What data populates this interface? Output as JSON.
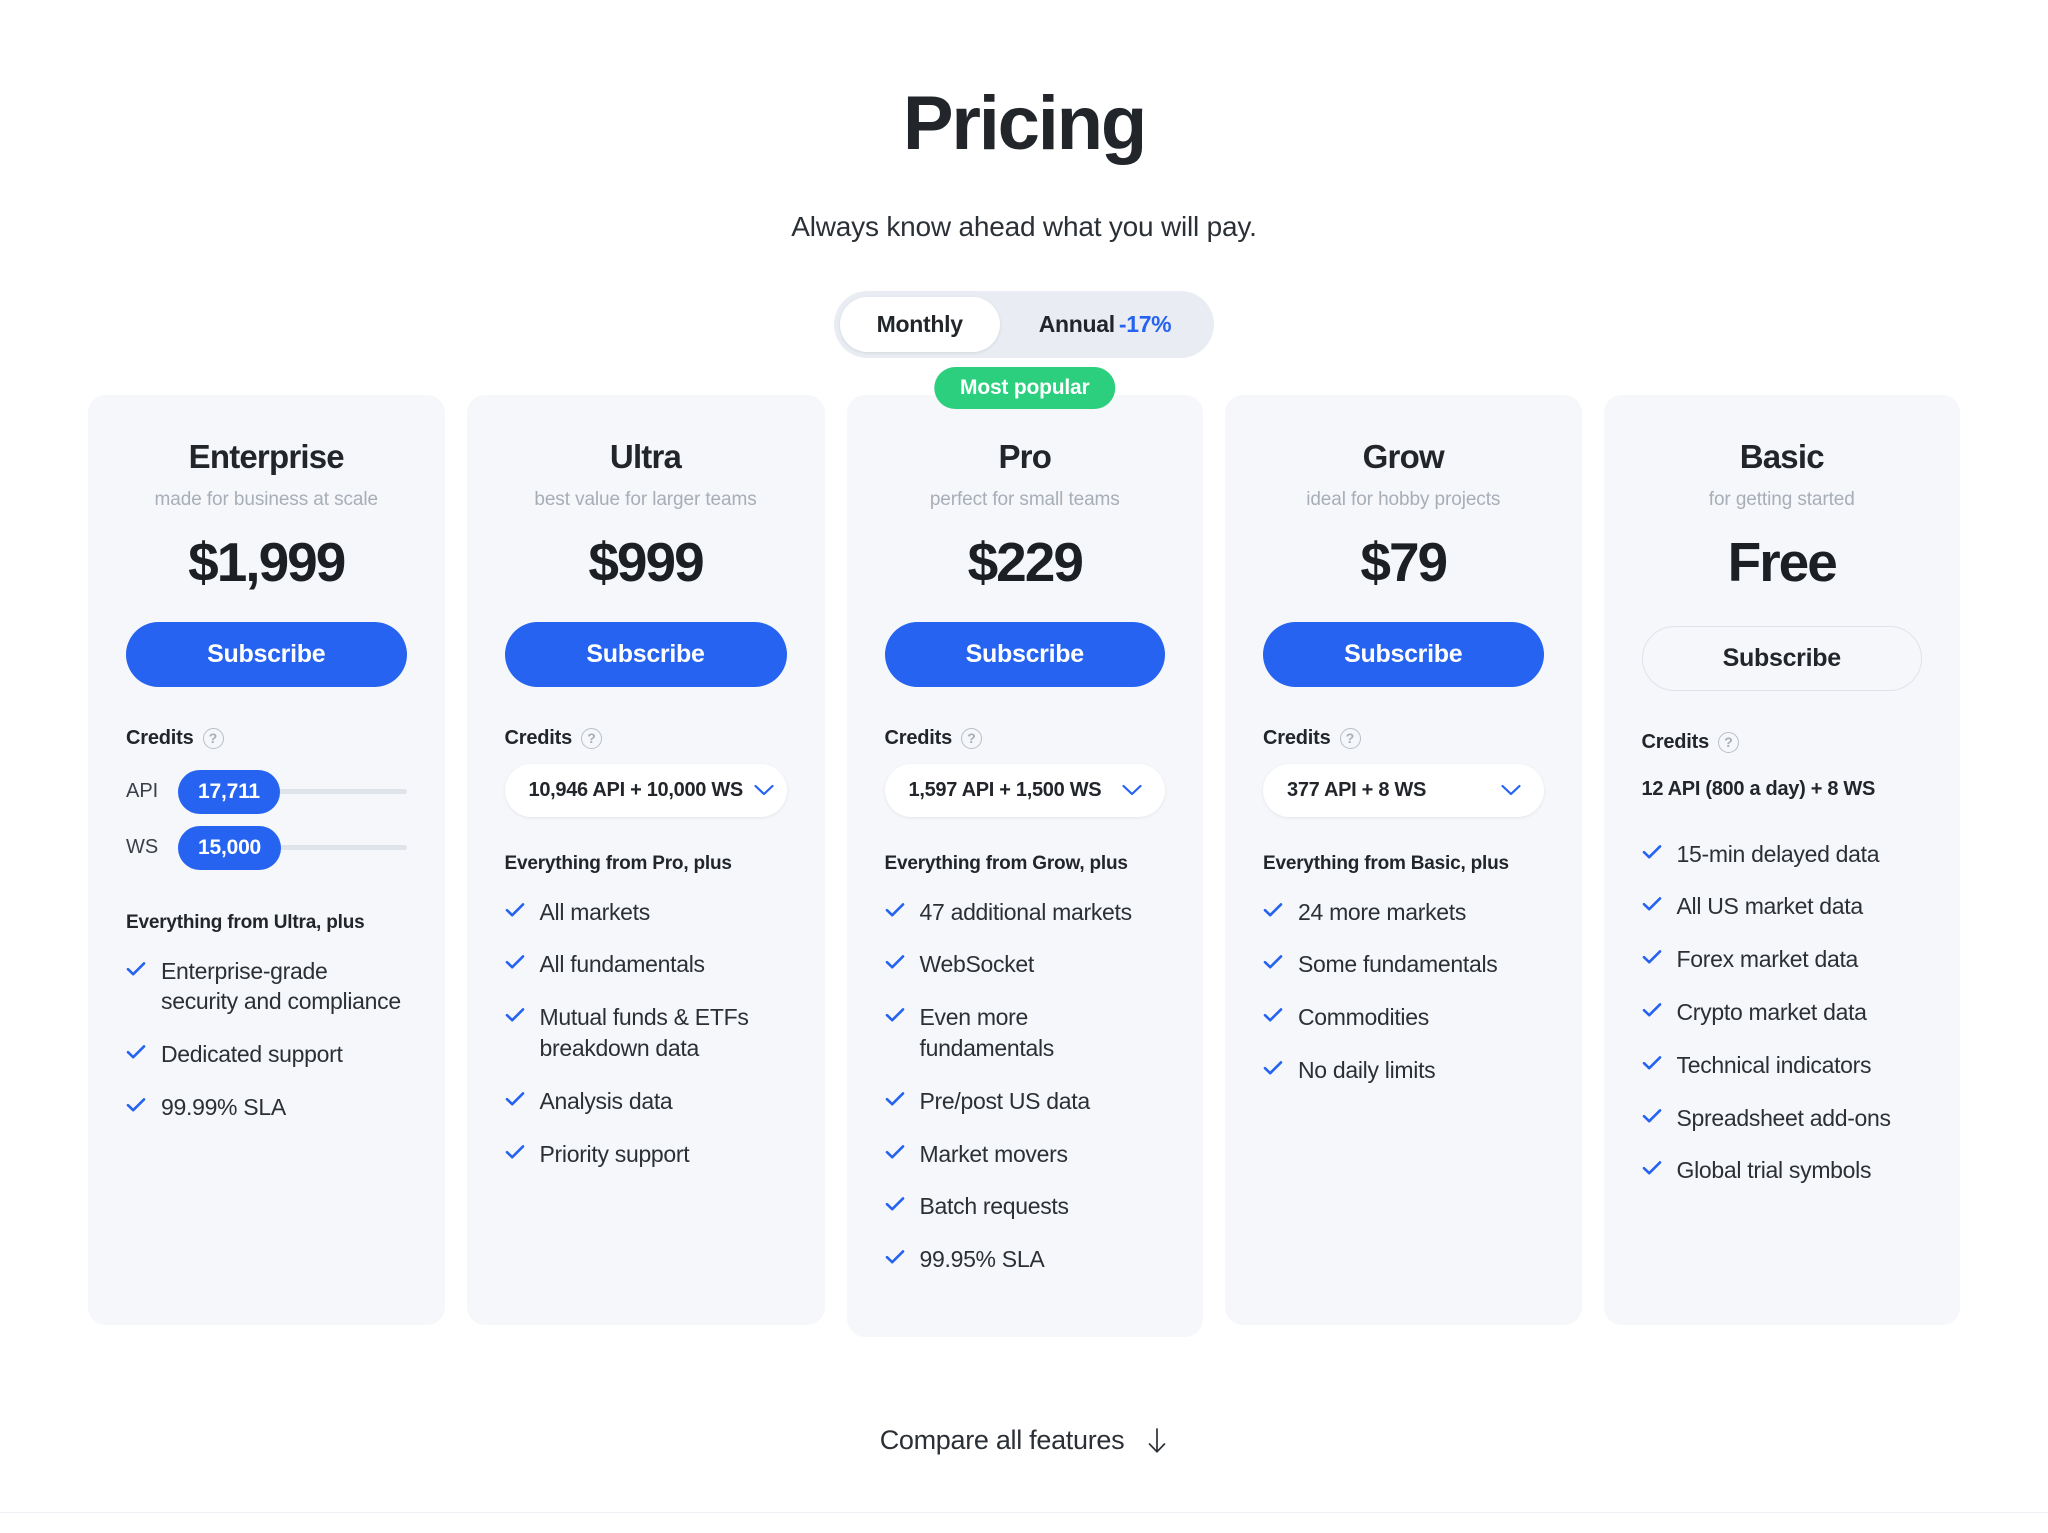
{
  "header": {
    "title": "Pricing",
    "subtitle": "Always know ahead what you will pay."
  },
  "billing_toggle": {
    "monthly_label": "Monthly",
    "annual_label": "Annual",
    "annual_discount": "-17%",
    "selected": "Monthly"
  },
  "icons": {
    "help": "help-circle-icon",
    "check": "check-icon",
    "chevron": "chevron-down-icon",
    "arrow_down": "arrow-down-icon"
  },
  "colors": {
    "accent": "#2563f0",
    "badge": "#2bcf7e",
    "card_bg": "#f5f7fa",
    "text": "#22262b",
    "muted": "#a8aeb7",
    "track": "#dfe3ea"
  },
  "credits_label": "Credits",
  "plans": [
    {
      "name": "Enterprise",
      "tagline": "made for business at scale",
      "price": "$1,999",
      "cta": "Subscribe",
      "cta_style": "filled",
      "badge": null,
      "credits_type": "sliders",
      "sliders": [
        {
          "key": "API",
          "value": "17,711",
          "fill_percent": 4
        },
        {
          "key": "WS",
          "value": "15,000",
          "fill_percent": 4
        }
      ],
      "inherits": "Everything from Ultra, plus",
      "features": [
        "Enterprise-grade security and compliance",
        "Dedicated support",
        "99.99% SLA"
      ]
    },
    {
      "name": "Ultra",
      "tagline": "best value for larger teams",
      "price": "$999",
      "cta": "Subscribe",
      "cta_style": "filled",
      "badge": null,
      "credits_type": "select",
      "credits_value": "10,946 API + 10,000 WS",
      "inherits": "Everything from Pro, plus",
      "features": [
        "All markets",
        "All fundamentals",
        "Mutual funds & ETFs breakdown data",
        "Analysis data",
        "Priority support"
      ]
    },
    {
      "name": "Pro",
      "tagline": "perfect for small teams",
      "price": "$229",
      "cta": "Subscribe",
      "cta_style": "filled",
      "badge": "Most popular",
      "credits_type": "select",
      "credits_value": "1,597 API + 1,500 WS",
      "inherits": "Everything from Grow, plus",
      "features": [
        "47 additional markets",
        "WebSocket",
        "Even more fundamentals",
        "Pre/post US data",
        "Market movers",
        "Batch requests",
        "99.95% SLA"
      ]
    },
    {
      "name": "Grow",
      "tagline": "ideal for hobby projects",
      "price": "$79",
      "cta": "Subscribe",
      "cta_style": "filled",
      "badge": null,
      "credits_type": "select",
      "credits_value": "377 API + 8 WS",
      "inherits": "Everything from Basic, plus",
      "features": [
        "24 more markets",
        "Some fundamentals",
        "Commodities",
        "No daily limits"
      ]
    },
    {
      "name": "Basic",
      "tagline": "for getting started",
      "price": "Free",
      "cta": "Subscribe",
      "cta_style": "outline",
      "badge": null,
      "credits_type": "text",
      "credits_value": "12 API (800 a day) + 8 WS",
      "inherits": null,
      "features": [
        "15-min delayed data",
        "All US market data",
        "Forex market data",
        "Crypto market data",
        "Technical indicators",
        "Spreadsheet add-ons",
        "Global trial symbols"
      ]
    }
  ],
  "footer": {
    "compare_label": "Compare all features"
  }
}
